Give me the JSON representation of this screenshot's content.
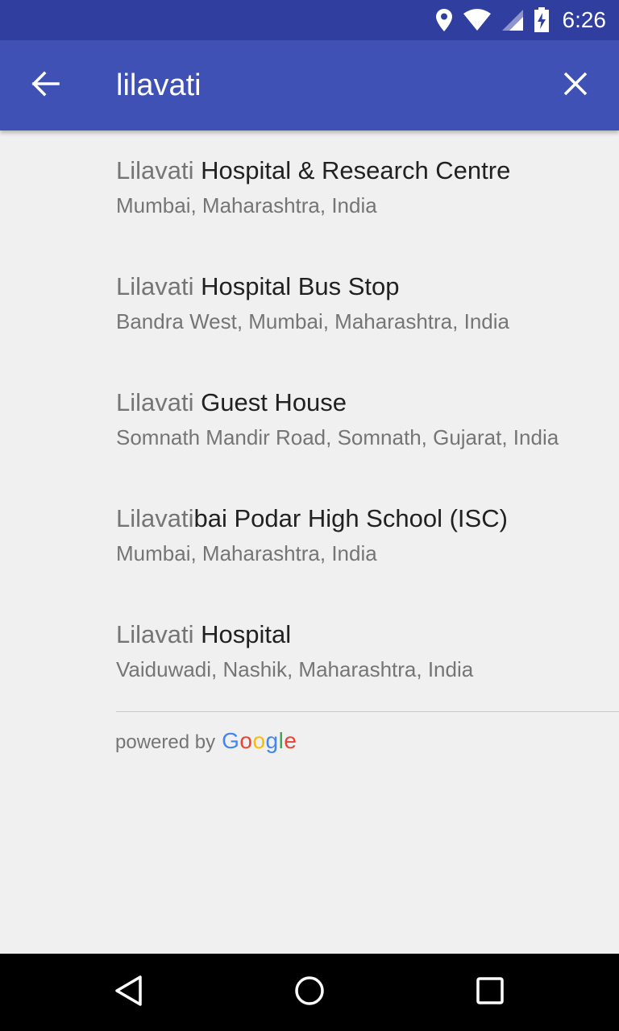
{
  "status_bar": {
    "time": "6:26",
    "icons": [
      "location-icon",
      "wifi-icon",
      "cell-signal-icon",
      "battery-charging-icon"
    ]
  },
  "app_bar": {
    "back_icon": "arrow-back-icon",
    "search_value": "lilavati",
    "clear_icon": "close-icon",
    "color": "#3f51b5",
    "status_color": "#303f9f"
  },
  "results": [
    {
      "match": "Lilavati",
      "rest": " Hospital & Research Centre",
      "subtitle": "Mumbai, Maharashtra, India"
    },
    {
      "match": "Lilavati",
      "rest": " Hospital Bus Stop",
      "subtitle": "Bandra West, Mumbai, Maharashtra, India"
    },
    {
      "match": "Lilavati",
      "rest": " Guest House",
      "subtitle": "Somnath Mandir Road, Somnath, Gujarat, India"
    },
    {
      "match": "Lilavati",
      "rest": "bai Podar High School (ISC)",
      "subtitle": "Mumbai, Maharashtra, India"
    },
    {
      "match": "Lilavati",
      "rest": " Hospital",
      "subtitle": "Vaiduwadi, Nashik, Maharashtra, India"
    }
  ],
  "attribution": {
    "prefix": "powered by",
    "brand": "Google",
    "brand_colors": [
      "#4285f4",
      "#ea4335",
      "#fbbc05",
      "#4285f4",
      "#34a853",
      "#ea4335"
    ]
  },
  "nav_bar": {
    "icons": [
      "back-triangle-icon",
      "home-circle-icon",
      "recents-square-icon"
    ]
  }
}
